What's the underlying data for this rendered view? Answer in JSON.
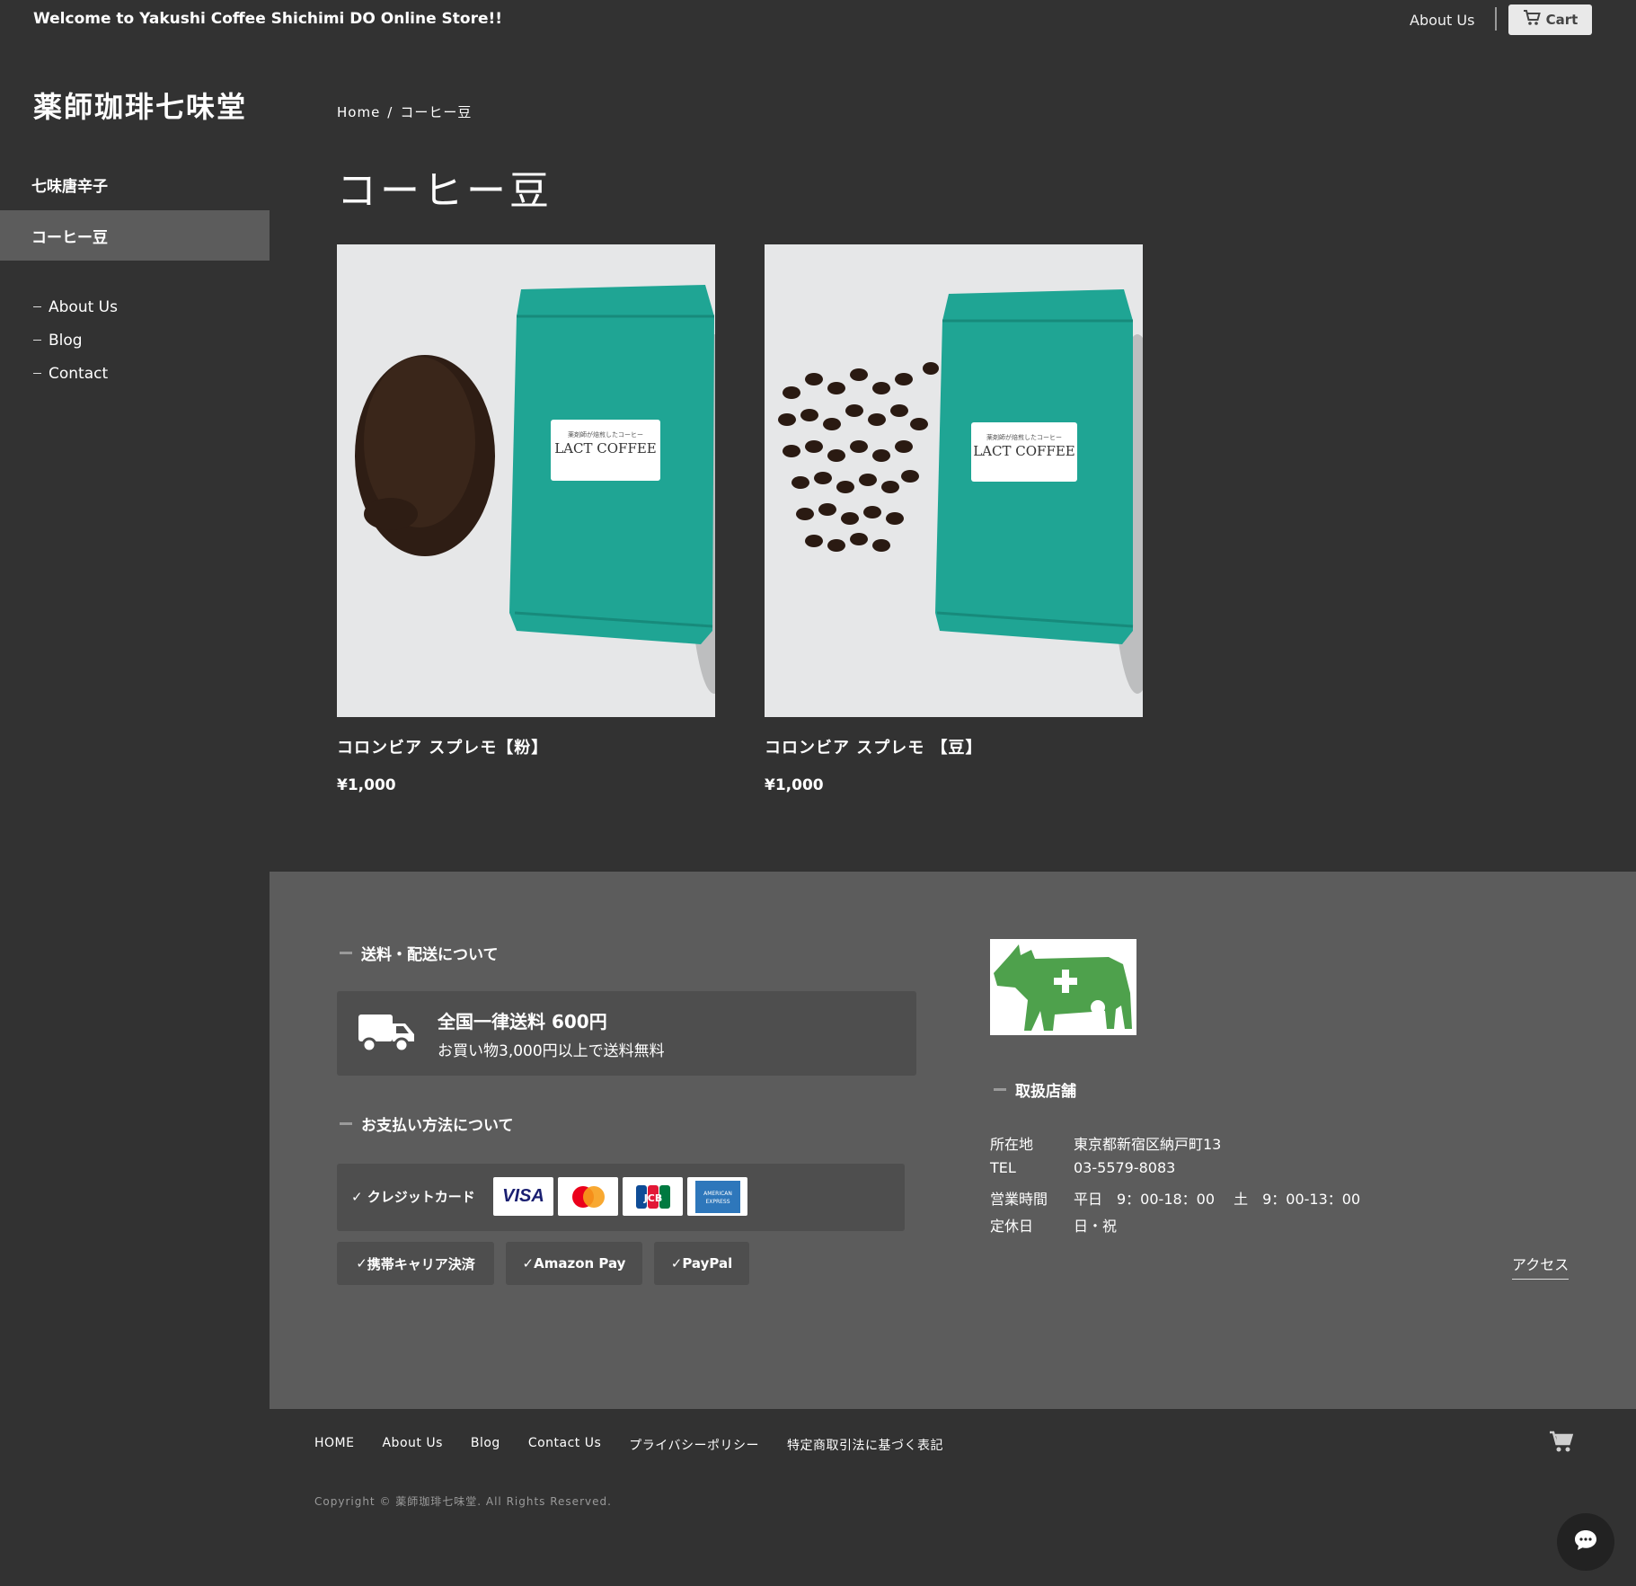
{
  "topbar": {
    "welcome": "Welcome to Yakushi Coffee Shichimi DO Online Store!!",
    "about": "About Us",
    "cart": "Cart"
  },
  "sidebar": {
    "logo": "薬師珈琲七味堂",
    "categories": [
      {
        "label": "七味唐辛子",
        "active": false
      },
      {
        "label": "コーヒー豆",
        "active": true
      }
    ],
    "links": [
      "About Us",
      "Blog",
      "Contact"
    ]
  },
  "breadcrumb": {
    "home": "Home",
    "sep": "/",
    "current": "コーヒー豆"
  },
  "page_title": "コーヒー豆",
  "products": [
    {
      "name": "コロンビア スプレモ【粉】",
      "price": "¥1,000",
      "bag_label_small": "薬剤師が焙煎したコーヒー",
      "bag_label": "LACT COFFEE"
    },
    {
      "name": "コロンビア スプレモ 【豆】",
      "price": "¥1,000",
      "bag_label_small": "薬剤師が焙煎したコーヒー",
      "bag_label": "LACT COFFEE"
    }
  ],
  "shipping": {
    "heading": "送料・配送について",
    "title": "全国一律送料 600円",
    "subtitle": "お買い物3,000円以上で送料無料"
  },
  "payment": {
    "heading": "お支払い方法について",
    "credit_label": "クレジットカード",
    "cards": [
      "VISA",
      "Mastercard",
      "JCB",
      "AMERICAN EXPRESS"
    ],
    "chips": [
      "携帯キャリア決済",
      "Amazon Pay",
      "PayPal"
    ]
  },
  "store": {
    "heading": "取扱店舗",
    "rows": [
      {
        "key": "所在地",
        "value": "東京都新宿区納戸町13"
      },
      {
        "key": "TEL",
        "value": "03-5579-8083"
      },
      {
        "key": "営業時間",
        "value": "平日　9：00-18：00　 土　9：00-13：00"
      },
      {
        "key": "定休日",
        "value": "日・祝"
      }
    ],
    "access": "アクセス"
  },
  "footer": {
    "nav": [
      "HOME",
      "About Us",
      "Blog",
      "Contact Us",
      "プライバシーポリシー",
      "特定商取引法に基づく表記"
    ],
    "copyright": "Copyright © 薬師珈琲七味堂. All Rights Reserved."
  },
  "colors": {
    "background": "#323232",
    "panel": "#5c5c5c",
    "box": "#4e4e4e",
    "bag_teal": "#1fa594",
    "logo_green": "#4ea14c"
  },
  "icons": [
    "cart-icon",
    "truck-icon",
    "check-icon",
    "chat-icon",
    "cow-cross-logo"
  ]
}
